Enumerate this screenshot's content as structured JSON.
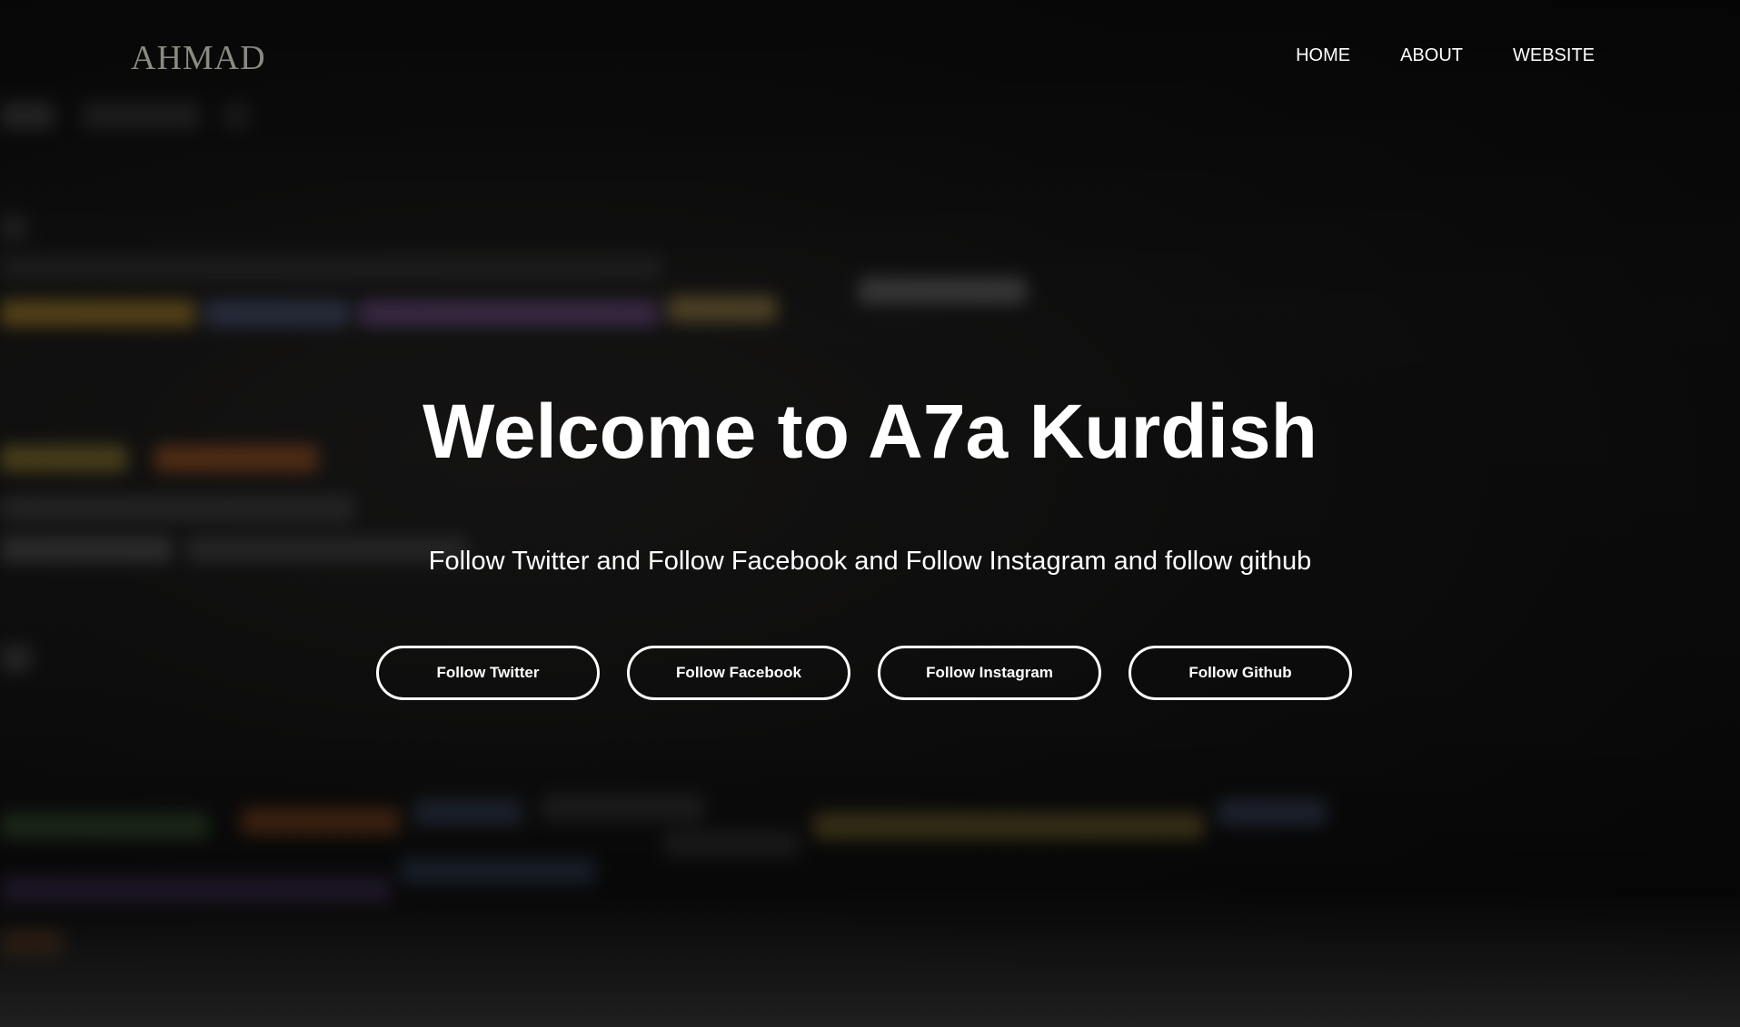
{
  "header": {
    "logo": "AHMAD",
    "nav": [
      {
        "label": "HOME"
      },
      {
        "label": "ABOUT"
      },
      {
        "label": "WEBSITE"
      }
    ]
  },
  "hero": {
    "title": "Welcome to A7a Kurdish",
    "subtitle": "Follow Twitter and Follow Facebook and Follow Instagram and follow github",
    "buttons": [
      {
        "label": "Follow Twitter"
      },
      {
        "label": "Follow Facebook"
      },
      {
        "label": "Follow Instagram"
      },
      {
        "label": "Follow Github"
      }
    ]
  },
  "colors": {
    "background": "#0b0b0b",
    "text": "#ffffff",
    "logo": "#8a8a80"
  }
}
